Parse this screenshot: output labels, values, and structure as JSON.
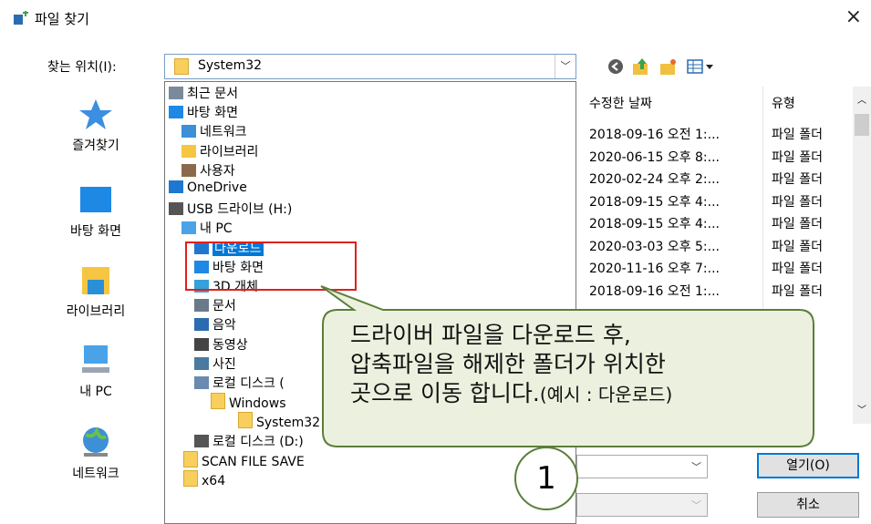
{
  "window": {
    "title": "파일 찾기",
    "close_glyph": "×"
  },
  "lookin": {
    "label": "찾는 위치(I):",
    "value": "System32"
  },
  "toolbar_icons": [
    "back-icon",
    "up-folder-icon",
    "new-folder-icon",
    "view-menu-icon"
  ],
  "places": [
    {
      "label": "즐겨찾기",
      "icon": "star-icon"
    },
    {
      "label": "바탕 화면",
      "icon": "desktop-icon"
    },
    {
      "label": "라이브러리",
      "icon": "library-icon"
    },
    {
      "label": "내 PC",
      "icon": "computer-icon"
    },
    {
      "label": "네트워크",
      "icon": "network-icon"
    }
  ],
  "dropdown_items": [
    {
      "label": "최근 문서",
      "icon": "recent-icon"
    },
    {
      "label": "바탕 화면",
      "icon": "desktop-icon"
    },
    {
      "label": "네트워크",
      "icon": "network-icon"
    },
    {
      "label": "라이브러리",
      "icon": "library-icon"
    },
    {
      "label": "사용자",
      "icon": "user-icon"
    },
    {
      "label": "OneDrive",
      "icon": "cloud-icon"
    },
    {
      "label": "USB 드라이브 (H:)",
      "icon": "drive-icon"
    },
    {
      "label": "내 PC",
      "icon": "computer-icon"
    },
    {
      "label": "다운로드",
      "icon": "download-icon"
    },
    {
      "label": "바탕 화면",
      "icon": "desktop-icon"
    },
    {
      "label": "3D 개체",
      "icon": "cube-icon"
    },
    {
      "label": "문서",
      "icon": "document-icon"
    },
    {
      "label": "음악",
      "icon": "music-icon"
    },
    {
      "label": "동영상",
      "icon": "video-icon"
    },
    {
      "label": "사진",
      "icon": "picture-icon"
    },
    {
      "label": "로컬 디스크 (",
      "icon": "local-disk-icon"
    },
    {
      "label": "Windows",
      "icon": "folder-icon"
    },
    {
      "label": "System32",
      "icon": "folder-icon"
    },
    {
      "label": "로컬 디스크 (D:)",
      "icon": "drive-icon"
    },
    {
      "label": "SCAN FILE SAVE",
      "icon": "folder-icon"
    },
    {
      "label": "x64",
      "icon": "folder-icon"
    }
  ],
  "file_list": {
    "date_header": "수정한 날짜",
    "type_header": "유형",
    "rows": [
      {
        "date": "2018-09-16 오전 1:...",
        "type": "파일 폴더"
      },
      {
        "date": "2020-06-15 오후 8:...",
        "type": "파일 폴더"
      },
      {
        "date": "2020-02-24 오후 2:...",
        "type": "파일 폴더"
      },
      {
        "date": "2018-09-15 오후 4:...",
        "type": "파일 폴더"
      },
      {
        "date": "2018-09-15 오후 4:...",
        "type": "파일 폴더"
      },
      {
        "date": "2020-03-03 오후 5:...",
        "type": "파일 폴더"
      },
      {
        "date": "2020-11-16 오후 7:...",
        "type": "파일 폴더"
      },
      {
        "date": "2018-09-16 오전 1:...",
        "type": "파일 폴더"
      }
    ]
  },
  "buttons": {
    "open": "열기(O)",
    "cancel": "취소"
  },
  "callout": {
    "line1": "드라이버 파일을 다운로드 후,",
    "line2": "압축파일을 해제한 폴더가 위치한",
    "line3_main": "곳으로 이동 합니다.",
    "line3_small": "(예시 : 다운로드)",
    "step_number": "1"
  },
  "colors": {
    "selection": "#0078d7",
    "highlight_box": "#e0201a",
    "callout_fill": "#ebf1de",
    "callout_border": "#5b7e3a"
  }
}
